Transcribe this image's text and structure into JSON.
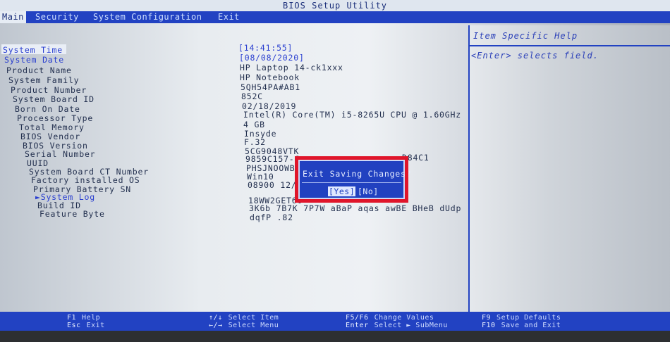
{
  "title": "BIOS Setup Utility",
  "menu": [
    {
      "label": "Main",
      "active": true
    },
    {
      "label": "Security",
      "active": false
    },
    {
      "label": "System Configuration",
      "active": false
    },
    {
      "label": "Exit",
      "active": false
    }
  ],
  "fields": [
    {
      "label": "System Time",
      "value": "[14:41:55]"
    },
    {
      "label": "System Date",
      "value": "[08/08/2020]"
    },
    {
      "label": "Product Name",
      "value": "HP Laptop 14-ck1xxx"
    },
    {
      "label": "System Family",
      "value": "HP Notebook"
    },
    {
      "label": "Product Number",
      "value": "5QH54PA#AB1"
    },
    {
      "label": "System Board ID",
      "value": "852C"
    },
    {
      "label": "Born On Date",
      "value": "02/18/2019"
    },
    {
      "label": "Processor Type",
      "value": "Intel(R) Core(TM) i5-8265U CPU @ 1.60GHz"
    },
    {
      "label": "Total Memory",
      "value": "4 GB"
    },
    {
      "label": "BIOS Vendor",
      "value": "Insyde"
    },
    {
      "label": "BIOS Version",
      "value": "F.32"
    },
    {
      "label": "Serial Number",
      "value": "5CG9048VTK"
    },
    {
      "label": "UUID",
      "value": "9859C157-C"
    },
    {
      "label": "System Board CT Number",
      "value": "PHSJNOOWBE"
    },
    {
      "label": "Factory installed OS",
      "value": "Win10"
    },
    {
      "label": "Primary Battery SN",
      "value": "08900 12/0"
    },
    {
      "label": "►System Log",
      "value": "18WW2GET60"
    },
    {
      "label": "Build ID",
      "value": "3K6b 7B7K 7P7W aBaP aqas awBE BHeB dUdp"
    },
    {
      "label": "Feature Byte",
      "value": "dqfP .82"
    }
  ],
  "uuid_tail": "D84C1",
  "help": {
    "title": "Item Specific Help",
    "text": "<Enter> selects field."
  },
  "dialog": {
    "title": "Exit Saving Changes?",
    "yes": "[Yes]",
    "no": "[No]"
  },
  "footer": [
    {
      "key": "F1",
      "desc": "Help"
    },
    {
      "key": "Esc",
      "desc": "Exit"
    },
    {
      "key": "↑/↓",
      "desc": "Select Item"
    },
    {
      "key": "←/→",
      "desc": "Select Menu"
    },
    {
      "key": "F5/F6",
      "desc": "Change Values"
    },
    {
      "key": "Enter",
      "desc": "Select ► SubMenu"
    },
    {
      "key": "F9",
      "desc": "Setup Defaults"
    },
    {
      "key": "F10",
      "desc": "Save and Exit"
    }
  ],
  "colors": {
    "menu_bar": "#2242c2",
    "dialog_bg": "#2141c0",
    "highlight_outline": "#e0152a",
    "help_text": "#2a3fb8"
  }
}
